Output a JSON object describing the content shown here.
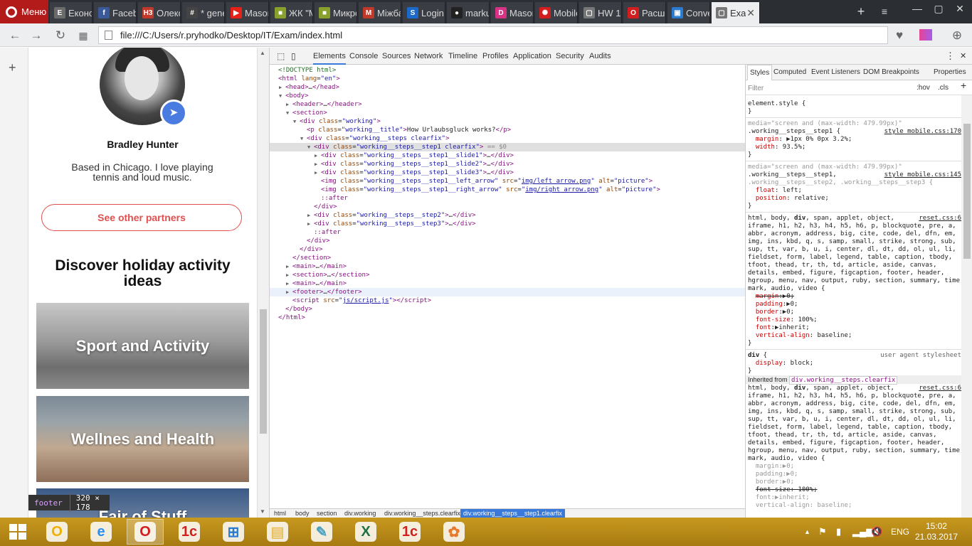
{
  "browser": {
    "menu_label": "Меню",
    "tabs": [
      {
        "label": "Економ",
        "icon": "E",
        "color": "#6b6b6b"
      },
      {
        "label": "Facebo",
        "icon": "f",
        "color": "#3b5998"
      },
      {
        "label": "Олексі",
        "icon": "Н3",
        "color": "#c0392b"
      },
      {
        "label": "* gene",
        "icon": "#",
        "color": "#444"
      },
      {
        "label": "Mason",
        "icon": "▶",
        "color": "#e62117"
      },
      {
        "label": "ЖК \"М",
        "icon": "■",
        "color": "#8aa02c"
      },
      {
        "label": "Микрс",
        "icon": "■",
        "color": "#8aa02c"
      },
      {
        "label": "Міжба",
        "icon": "M",
        "color": "#c0392b"
      },
      {
        "label": "Login t",
        "icon": "S",
        "color": "#1b6ac9"
      },
      {
        "label": "marku",
        "icon": "●",
        "color": "#222"
      },
      {
        "label": "Mason",
        "icon": "D",
        "color": "#d63384"
      },
      {
        "label": "Mobile",
        "icon": "✺",
        "color": "#d21e1e"
      },
      {
        "label": "HW 15",
        "icon": "▢",
        "color": "#777"
      },
      {
        "label": "Расши",
        "icon": "O",
        "color": "#d21e1e"
      },
      {
        "label": "Conve",
        "icon": "▣",
        "color": "#2a7ad0"
      },
      {
        "label": "Exa",
        "icon": "▢",
        "color": "#777",
        "active": true
      }
    ],
    "url": "file:///C:/Users/r.pryhodko/Desktop/IT/Exam/index.html"
  },
  "page": {
    "profile_name": "Bradley Hunter",
    "profile_desc": "Based in Chicago. I love playing tennis and loud music.",
    "partners_button": "See other partners",
    "section_title": "Discover holiday activity ideas",
    "cards": [
      "Sport and Activity",
      "Wellnes and Health",
      "Fair of Stuff"
    ],
    "tooltip_tag": "footer",
    "tooltip_size": "320 × 178"
  },
  "devtools": {
    "tabs": [
      "Elements",
      "Console",
      "Sources",
      "Network",
      "Timeline",
      "Profiles",
      "Application",
      "Security",
      "Audits"
    ],
    "dom_lines": [
      {
        "i": 0,
        "h": "<span class=cmt>&lt;!DOCTYPE html&gt;</span>"
      },
      {
        "i": 0,
        "h": "<span class=tgc>&lt;html</span> <span class=atn>lang</span>=<span class=atv>\"en\"</span><span class=tgc>&gt;</span>"
      },
      {
        "i": 1,
        "a": "▶",
        "h": "<span class=tgc>&lt;head&gt;</span>…<span class=tgc>&lt;/head&gt;</span>"
      },
      {
        "i": 1,
        "a": "▼",
        "h": "<span class=tgc>&lt;body&gt;</span>"
      },
      {
        "i": 2,
        "a": "▶",
        "h": "<span class=tgc>&lt;header&gt;</span>…<span class=tgc>&lt;/header&gt;</span>"
      },
      {
        "i": 2,
        "a": "▼",
        "h": "<span class=tgc>&lt;section&gt;</span>"
      },
      {
        "i": 3,
        "a": "▼",
        "h": "<span class=tgc>&lt;div</span> <span class=atn>class</span>=<span class=atv>\"working\"</span><span class=tgc>&gt;</span>"
      },
      {
        "i": 4,
        "h": "<span class=tgc>&lt;p</span> <span class=atn>class</span>=<span class=atv>\"working__title\"</span><span class=tgc>&gt;</span><span class=txt>How Urlaubsgluck works?</span><span class=tgc>&lt;/p&gt;</span>"
      },
      {
        "i": 4,
        "a": "▼",
        "h": "<span class=tgc>&lt;div</span> <span class=atn>class</span>=<span class=atv>\"working__steps clearfix\"</span><span class=tgc>&gt;</span>"
      },
      {
        "i": 5,
        "a": "▼",
        "sel": true,
        "h": "<span class=tgc>&lt;div</span> <span class=atn>class</span>=<span class=atv>\"working__steps__step1 clearfix\"</span><span class=tgc>&gt;</span> <span class=gry>== $0</span>"
      },
      {
        "i": 6,
        "a": "▶",
        "h": "<span class=tgc>&lt;div</span> <span class=atn>class</span>=<span class=atv>\"working__steps__step1__slide1\"</span><span class=tgc>&gt;</span>…<span class=tgc>&lt;/div&gt;</span>"
      },
      {
        "i": 6,
        "a": "▶",
        "h": "<span class=tgc>&lt;div</span> <span class=atn>class</span>=<span class=atv>\"working__steps__step1__slide2\"</span><span class=tgc>&gt;</span>…<span class=tgc>&lt;/div&gt;</span>"
      },
      {
        "i": 6,
        "a": "▶",
        "h": "<span class=tgc>&lt;div</span> <span class=atn>class</span>=<span class=atv>\"working__steps__step1__slide3\"</span><span class=tgc>&gt;</span>…<span class=tgc>&lt;/div&gt;</span>"
      },
      {
        "i": 6,
        "h": "<span class=tgc>&lt;img</span> <span class=atn>class</span>=<span class=atv>\"working__steps__step1__left_arrow\"</span> <span class=atn>src</span>=<span class=atv>\"<span class=lnk>img/left_arrow.png</span>\"</span> <span class=atn>alt</span>=<span class=atv>\"picture\"</span><span class=tgc>&gt;</span>"
      },
      {
        "i": 6,
        "h": "<span class=tgc>&lt;img</span> <span class=atn>class</span>=<span class=atv>\"working__steps__step1__right_arrow\"</span> <span class=atn>src</span>=<span class=atv>\"<span class=lnk>img/right_arrow.png</span>\"</span> <span class=atn>alt</span>=<span class=atv>\"picture\"</span><span class=tgc>&gt;</span>"
      },
      {
        "i": 6,
        "h": "<span class=pse>::after</span>"
      },
      {
        "i": 5,
        "h": "<span class=tgc>&lt;/div&gt;</span>"
      },
      {
        "i": 5,
        "a": "▶",
        "h": "<span class=tgc>&lt;div</span> <span class=atn>class</span>=<span class=atv>\"working__steps__step2\"</span><span class=tgc>&gt;</span>…<span class=tgc>&lt;/div&gt;</span>"
      },
      {
        "i": 5,
        "a": "▶",
        "h": "<span class=tgc>&lt;div</span> <span class=atn>class</span>=<span class=atv>\"working__steps__step3\"</span><span class=tgc>&gt;</span>…<span class=tgc>&lt;/div&gt;</span>"
      },
      {
        "i": 5,
        "h": "<span class=pse>::after</span>"
      },
      {
        "i": 4,
        "h": "<span class=tgc>&lt;/div&gt;</span>"
      },
      {
        "i": 3,
        "h": "<span class=tgc>&lt;/div&gt;</span>"
      },
      {
        "i": 2,
        "h": "<span class=tgc>&lt;/section&gt;</span>"
      },
      {
        "i": 2,
        "a": "▶",
        "h": "<span class=tgc>&lt;main&gt;</span>…<span class=tgc>&lt;/main&gt;</span>"
      },
      {
        "i": 2,
        "a": "▶",
        "h": "<span class=tgc>&lt;section&gt;</span>…<span class=tgc>&lt;/section&gt;</span>"
      },
      {
        "i": 2,
        "a": "▶",
        "h": "<span class=tgc>&lt;main&gt;</span>…<span class=tgc>&lt;/main&gt;</span>"
      },
      {
        "i": 2,
        "a": "▶",
        "hov": true,
        "h": "<span class=tgc>&lt;footer&gt;</span>…<span class=tgc>&lt;/footer&gt;</span>"
      },
      {
        "i": 2,
        "h": "<span class=tgc>&lt;script</span> <span class=atn>src</span>=<span class=atv>\"<span class=lnk>js/script.js</span>\"</span><span class=tgc>&gt;&lt;/script&gt;</span>"
      },
      {
        "i": 1,
        "h": "<span class=tgc>&lt;/body&gt;</span>"
      },
      {
        "i": 0,
        "h": "<span class=tgc>&lt;/html&gt;</span>"
      }
    ],
    "breadcrumbs": [
      "html",
      "body",
      "section",
      "div.working",
      "div.working__steps.clearfix",
      "div.working__steps__step1.clearfix"
    ],
    "styles_tabs": [
      "Styles",
      "Computed",
      "Event Listeners",
      "DOM Breakpoints",
      "Properties"
    ],
    "filter_placeholder": "Filter",
    "hov_label": ":hov",
    "cls_label": ".cls",
    "styles_lines": [
      {
        "h": "<span class=sel>element.style {</span>"
      },
      {
        "h": "}"
      },
      {
        "sep": true
      },
      {
        "h": "<span class=dim2>media=\"screen and (max-width: 479.99px)\"</span>"
      },
      {
        "h": "<span class=sel>.working__steps__step1 {</span>",
        "src": "style_mobile.css:170"
      },
      {
        "h": "  <span class=prop>margin</span>: ▶1px 0% 0px 3.2%;"
      },
      {
        "h": "  <span class=prop>width</span>: 93.5%;"
      },
      {
        "h": "}"
      },
      {
        "sep": true
      },
      {
        "h": "<span class=dim2>media=\"screen and (max-width: 479.99px)\"</span>"
      },
      {
        "h": "<span class=sel>.working__steps__step1,</span>",
        "src": "style_mobile.css:145"
      },
      {
        "h": "<span class=dim2>.working__steps__step2, .working__steps__step3 {</span>"
      },
      {
        "h": "  <span class=prop>float</span>: left;"
      },
      {
        "h": "  <span class=prop>position</span>: relative;"
      },
      {
        "h": "}"
      },
      {
        "sep": true
      },
      {
        "h": "html, body, <b>div</b>, span, applet, object,",
        "src": "reset.css:6"
      },
      {
        "h": "iframe, h1, h2, h3, h4, h5, h6, p, blockquote, pre, a,"
      },
      {
        "h": "abbr, acronym, address, big, cite, code, del, dfn, em,"
      },
      {
        "h": "img, ins, kbd, q, s, samp, small, strike, strong, sub,"
      },
      {
        "h": "sup, tt, var, b, u, i, center, dl, dt, dd, ol, ul, li,"
      },
      {
        "h": "fieldset, form, label, legend, table, caption, tbody,"
      },
      {
        "h": "tfoot, thead, tr, th, td, article, aside, canvas,"
      },
      {
        "h": "details, embed, figure, figcaption, footer, header,"
      },
      {
        "h": "hgroup, menu, nav, output, ruby, section, summary, time,"
      },
      {
        "h": "mark, audio, video {"
      },
      {
        "h": "  <span class=strike><span class=prop>margin</span>:▶0;</span>"
      },
      {
        "h": "  <span class=prop>padding</span>:▶0;"
      },
      {
        "h": "  <span class=prop>border</span>:▶0;"
      },
      {
        "h": "  <span class=prop>font-size</span>: 100%;"
      },
      {
        "h": "  <span class=prop>font</span>:▶inherit;"
      },
      {
        "h": "  <span class=prop>vertical-align</span>: baseline;"
      },
      {
        "h": "}"
      },
      {
        "sep": true
      },
      {
        "h": "<b>div</b> {",
        "ua": "user agent stylesheet"
      },
      {
        "h": "  <span class=prop>display</span>: block;"
      },
      {
        "h": "}"
      },
      {
        "inh": true,
        "label": "Inherited from ",
        "tag": "div.working__steps.clearfix"
      },
      {
        "h": "html, body, <b>div</b>, span, applet, object,",
        "src": "reset.css:6"
      },
      {
        "h": "iframe, h1, h2, h3, h4, h5, h6, p, blockquote, pre, a,"
      },
      {
        "h": "abbr, acronym, address, big, cite, code, del, dfn, em,"
      },
      {
        "h": "img, ins, kbd, q, s, samp, small, strike, strong, sub,"
      },
      {
        "h": "sup, tt, var, b, u, i, center, dl, dt, dd, ol, ul, li,"
      },
      {
        "h": "fieldset, form, label, legend, table, caption, tbody,"
      },
      {
        "h": "tfoot, thead, tr, th, td, article, aside, canvas,"
      },
      {
        "h": "details, embed, figure, figcaption, footer, header,"
      },
      {
        "h": "hgroup, menu, nav, output, ruby, section, summary, time,"
      },
      {
        "h": "mark, audio, video {"
      },
      {
        "h": "  <span class=dim2>margin:▶0;</span>"
      },
      {
        "h": "  <span class=dim2>padding:▶0;</span>"
      },
      {
        "h": "  <span class=dim2>border:▶0;</span>"
      },
      {
        "h": "  <span class='strike'>font-size: 100%;</span>"
      },
      {
        "h": "  <span class=dim2>font:▶inherit;</span>"
      },
      {
        "h": "  <span class=dim2>vertical-align: baseline;</span>"
      }
    ]
  },
  "taskbar": {
    "lang": "ENG",
    "time": "15:02",
    "date": "21.03.2017",
    "apps": [
      "outlook",
      "ie",
      "opera",
      "1c",
      "network",
      "explorer",
      "notes",
      "excel",
      "1c-2",
      "paint"
    ]
  }
}
